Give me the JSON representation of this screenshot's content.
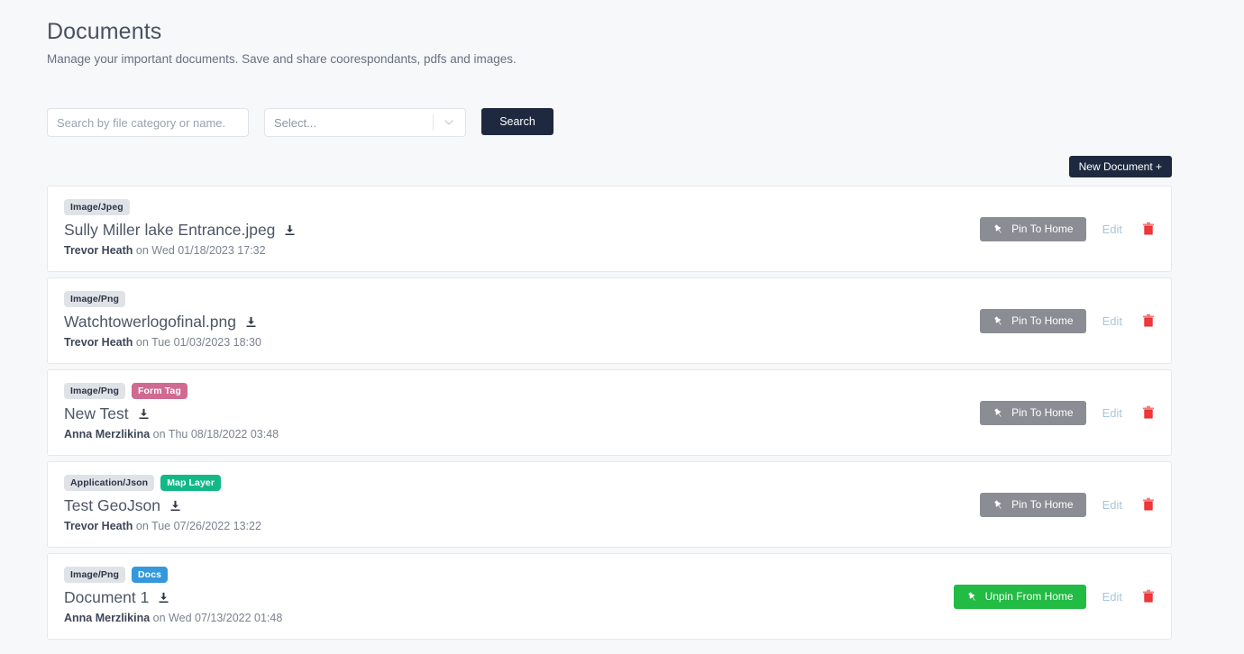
{
  "header": {
    "title": "Documents",
    "subtitle": "Manage your important documents. Save and share coorespondants, pdfs and images."
  },
  "filters": {
    "search_placeholder": "Search by file category or name.",
    "search_value": "",
    "select_placeholder": "Select...",
    "select_value": "",
    "select_options": [],
    "search_button": "Search",
    "chevron_icon": "chevron-down-icon"
  },
  "actions": {
    "new_document": "New Document +"
  },
  "labels": {
    "pin": "Pin To Home",
    "unpin": "Unpin From Home",
    "edit": "Edit",
    "on": "on",
    "download_icon": "download-icon",
    "delete_icon": "trash-icon",
    "pin_icon": "pushpin-icon"
  },
  "colors": {
    "page_bg": "#f7f8fa",
    "card_bg": "#ffffff",
    "dark_button": "#1e293f",
    "pin_gray": "#8a8d93",
    "pin_green": "#22bb44",
    "edit_link": "#a8c6dd",
    "trash_red": "#e8262a",
    "tag_mime": "#dfe3e8",
    "tag_form": "#cf6a90",
    "tag_map": "#13b887",
    "tag_docs": "#3498db"
  },
  "documents": [
    {
      "mime": "Image/Jpeg",
      "tag": null,
      "tag_type": null,
      "name": "Sully Miller lake Entrance.jpeg",
      "author": "Trevor Heath",
      "date": "Wed 01/18/2023 17:32",
      "pinned": false
    },
    {
      "mime": "Image/Png",
      "tag": null,
      "tag_type": null,
      "name": "Watchtowerlogofinal.png",
      "author": "Trevor Heath",
      "date": "Tue 01/03/2023 18:30",
      "pinned": false
    },
    {
      "mime": "Image/Png",
      "tag": "Form Tag",
      "tag_type": "form",
      "name": "New Test",
      "author": "Anna Merzlikina",
      "date": "Thu 08/18/2022 03:48",
      "pinned": false
    },
    {
      "mime": "Application/Json",
      "tag": "Map Layer",
      "tag_type": "map",
      "name": "Test GeoJson",
      "author": "Trevor Heath",
      "date": "Tue 07/26/2022 13:22",
      "pinned": false
    },
    {
      "mime": "Image/Png",
      "tag": "Docs",
      "tag_type": "docs",
      "name": "Document 1",
      "author": "Anna Merzlikina",
      "date": "Wed 07/13/2022 01:48",
      "pinned": true
    }
  ]
}
